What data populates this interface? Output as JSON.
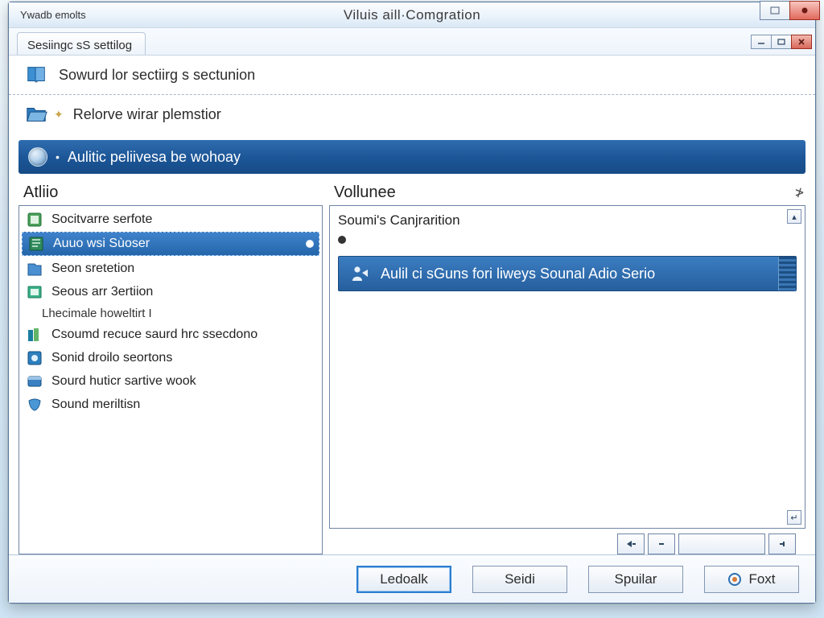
{
  "window": {
    "app_label": "Ywadb emolts",
    "title": "Viluis aill·Comgration"
  },
  "tabs": {
    "active": "Sesiingc sS settilog"
  },
  "header": {
    "row1": "Sowurd lor sectiirg s sectunion",
    "row2": "Relorve wirar plemstior"
  },
  "banner": {
    "label": "Aulitic peliivesa be wohoay"
  },
  "columns": {
    "left_header": "Atliio",
    "right_header": "Vollunee"
  },
  "left_list": {
    "items": [
      "Socitvarre serfote",
      "Auuo wsi Sùoser",
      "Seon sretetion",
      "Seous arr 3ertiion",
      "Lhecimale howeltirt I",
      "Csoumd recuce saurd hrc ssecdono",
      "Sonid droilo seortons",
      "Sourd huticr sartive wook",
      "Sound meriltisn"
    ],
    "selected_index": 1
  },
  "right_panel": {
    "subtitle": "Soumi's Canjrarition",
    "selected_item": "Aulil ci sGuns fori liweys Sounal Adio Serio"
  },
  "footer": {
    "primary": "Ledoalk",
    "mid1": "Seidi",
    "mid2": "Spuilar",
    "last": "Foxt"
  }
}
